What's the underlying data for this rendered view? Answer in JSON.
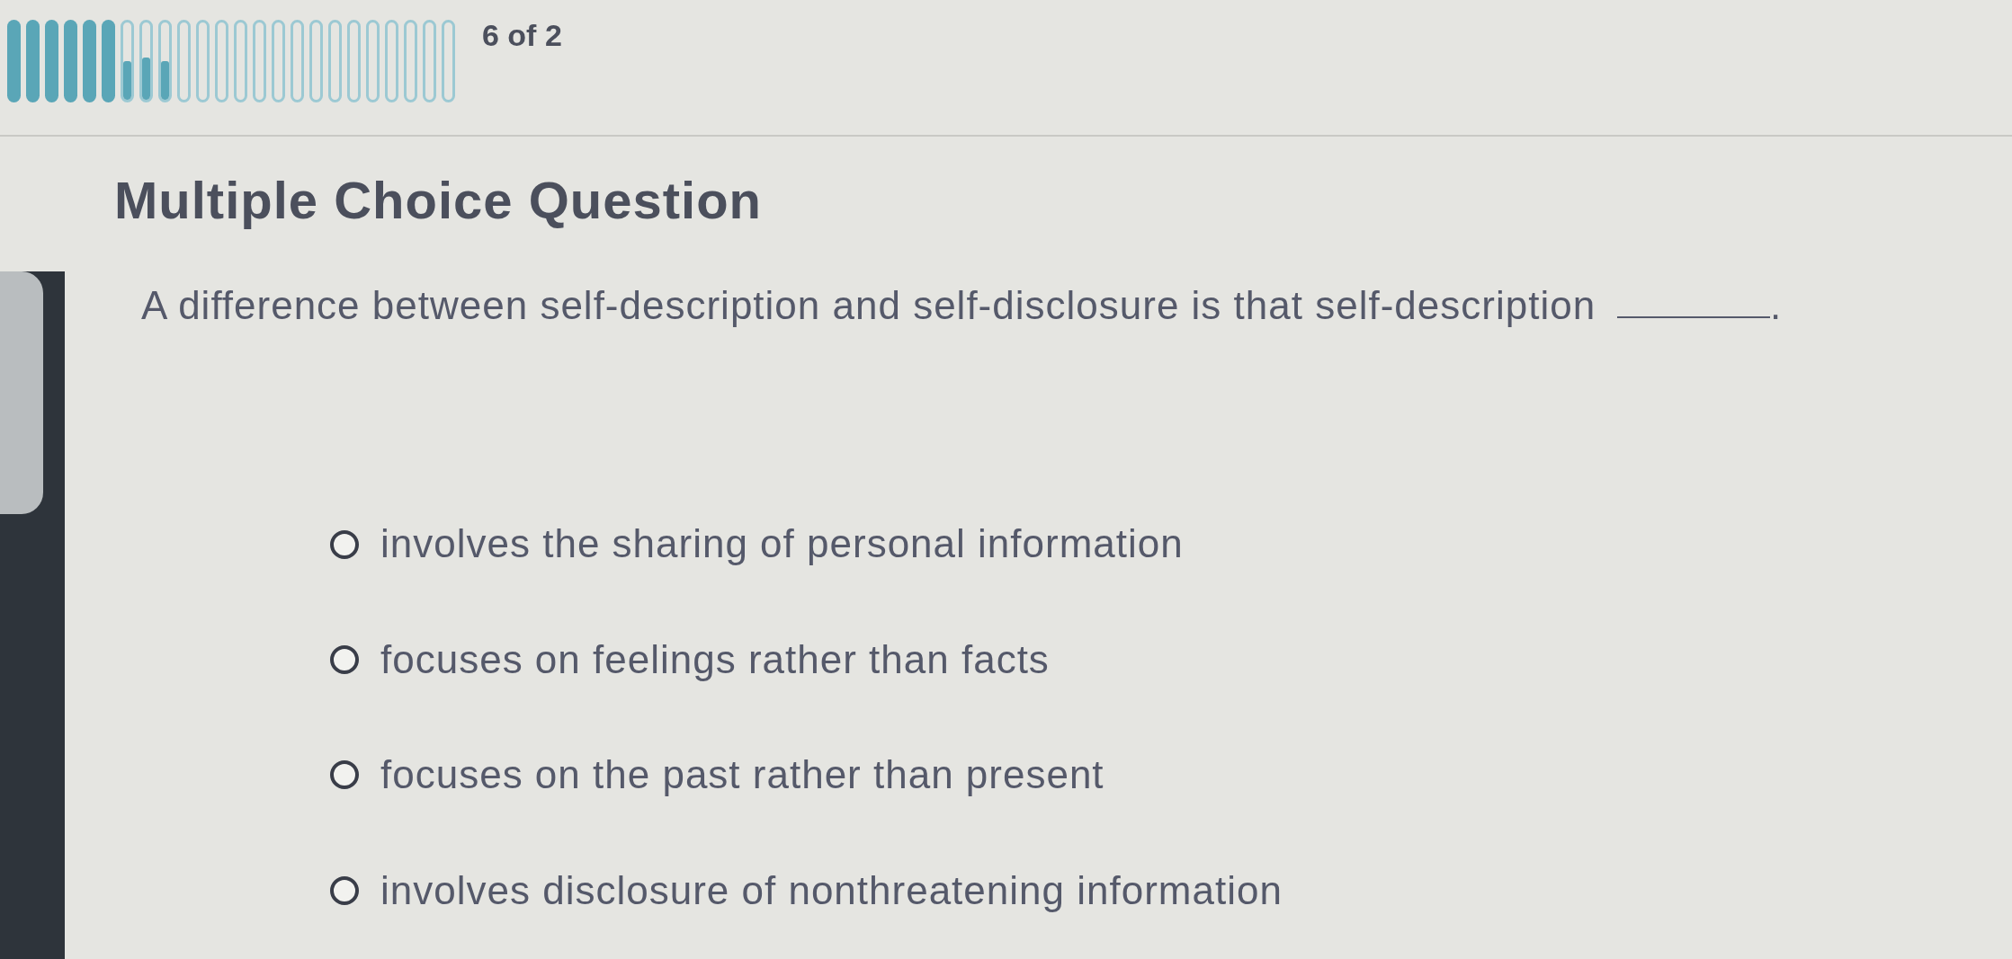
{
  "progress": {
    "segments": [
      {
        "kind": "full"
      },
      {
        "kind": "full"
      },
      {
        "kind": "full"
      },
      {
        "kind": "full"
      },
      {
        "kind": "full"
      },
      {
        "kind": "full"
      },
      {
        "kind": "partial",
        "level": 0.5
      },
      {
        "kind": "partial",
        "level": 0.55
      },
      {
        "kind": "partial",
        "level": 0.5
      },
      {
        "kind": "empty"
      },
      {
        "kind": "empty"
      },
      {
        "kind": "empty"
      },
      {
        "kind": "empty"
      },
      {
        "kind": "empty"
      },
      {
        "kind": "empty"
      },
      {
        "kind": "empty"
      },
      {
        "kind": "empty"
      },
      {
        "kind": "empty"
      },
      {
        "kind": "empty"
      },
      {
        "kind": "empty"
      },
      {
        "kind": "empty"
      },
      {
        "kind": "empty"
      },
      {
        "kind": "empty"
      },
      {
        "kind": "empty"
      }
    ],
    "counter": "6 of 2"
  },
  "question": {
    "type_label": "Multiple Choice Question",
    "prompt": "A difference between self-description and self-disclosure is that self-description",
    "prompt_end": "."
  },
  "options": [
    {
      "label": "involves the sharing of personal information",
      "selected": false
    },
    {
      "label": "focuses on feelings rather than facts",
      "selected": false
    },
    {
      "label": "focuses on the past rather than present",
      "selected": false
    },
    {
      "label": "involves disclosure of nonthreatening information",
      "selected": false
    }
  ]
}
